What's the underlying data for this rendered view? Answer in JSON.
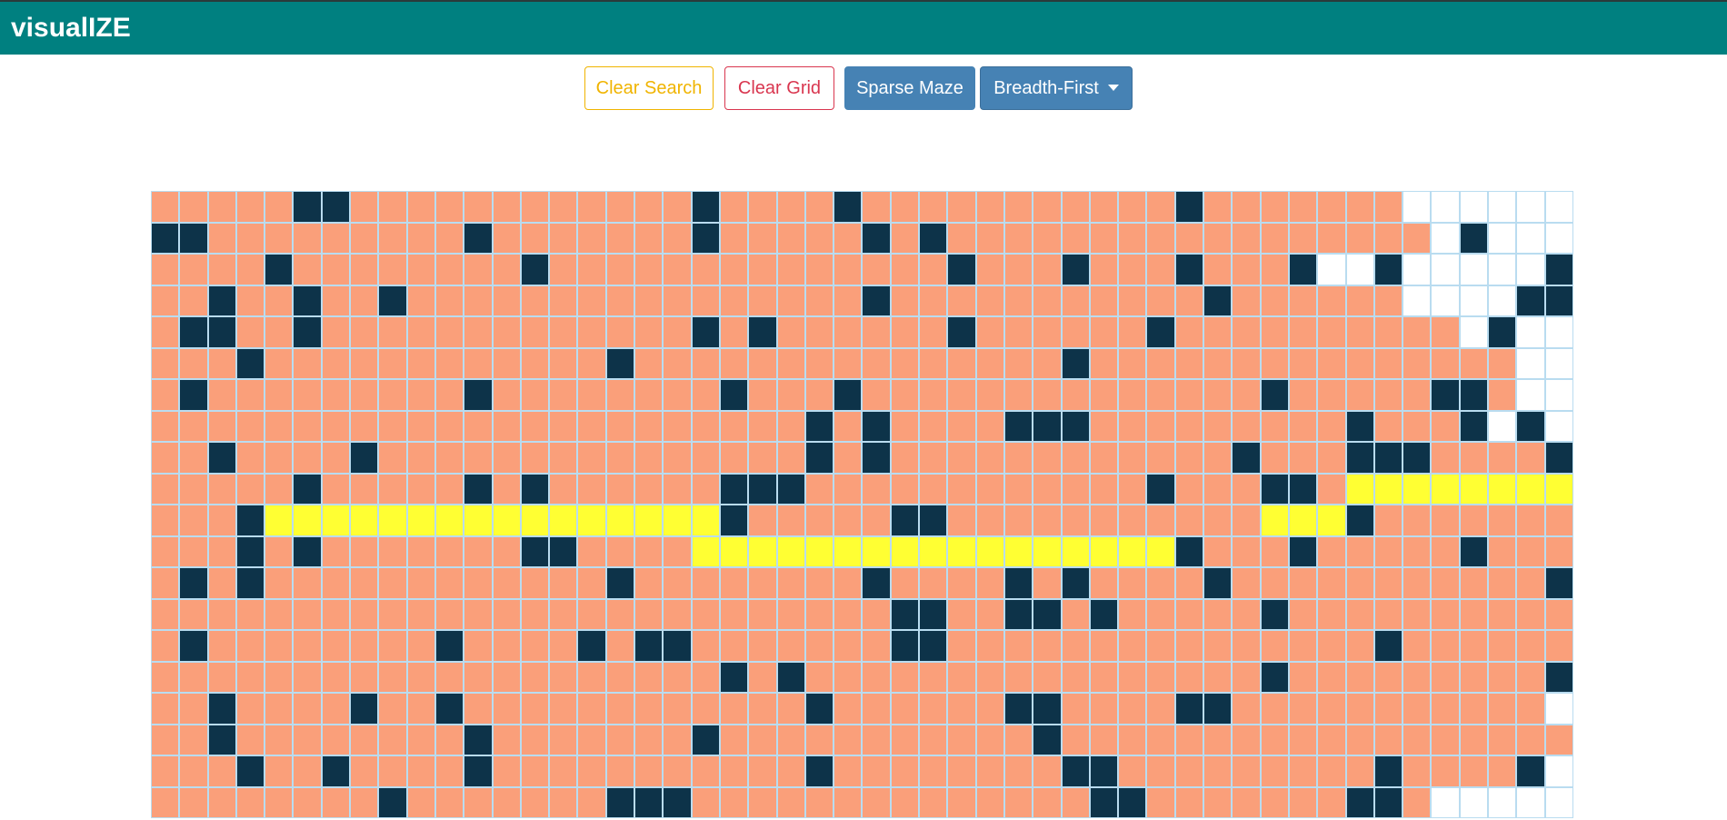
{
  "navbar": {
    "brand": "visualIZE"
  },
  "toolbar": {
    "clear_search": "Clear Search",
    "clear_grid": "Clear Grid",
    "maze_button": "Sparse Maze",
    "algorithm_dropdown": "Breadth-First"
  },
  "grid": {
    "rows": 20,
    "cols": 50,
    "legend": {
      ".": "unvisited",
      "v": "visited",
      "w": "wall",
      "p": "path"
    },
    "cells": [
      "vvvvvwwvvvvvvvvvvvvwvvvvwvvvvvvvvvvvwvvvvvvv......",
      "wwvvvvvvvvvwvvvvvvvwvvvvvwvwvvvvvvvvvvvvvvvvv.w...",
      "vvvvwvvvvvvvvwvvvvvvvvvvvvvvwvvvwvvvwvvvw..w.....w",
      "vvwvvwvvwvvvvvvvvvvvvvvvvwvvvvvvvvvvvwvvvvvv....ww.",
      "vwwvvwvvvvvvvvvvvvvwvwvvvvvvwvvvvvvwvvvvvvvvvv.w..w...",
      "vvvwvvvvvvvvvvvvwvvvvvvvvvvvvvvvwvvvvvvvvvvvvvvv......",
      "vwvvvvvvvvvwvvvvvvvvwvvvwvvvvvvvvvvvvvvwvvvvvwwv..w.ww",
      "vvvvvvvvvvvvvvvvvvvvvvvwvwvvvvwwwvvvvvvvvvwvvvw w.....",
      "vvwvvvvwvvvvvvvvvvvvvvvwvwvvvvvvvvvvvvwvvvwwwvvvvw....",
      "vvvvvwvvvvvwvwvvvvvvwwwvvvvvvvvvvvvwvvvwwvpppppppppw..",
      "vvvwppppppppppppppppwvvvvvwwvvvvvvvvvvvpppwvvvvvvvpw.w.",
      "vvvwvwvvvvvvvwwvvvvpppppppppppppppppwvvvwvvvvvwvvvv..w",
      "vwvwvvvvvvvvvvvvwvvvvvvvvwvvvvwvwvvvvwvvvvvvvvvvvw....",
      "vvvvvvvvvvvvvvvvvvvvvvvvvvwwvvwwvwvvvvvwvvvvvvvvvvv.w.",
      "vwvvvvvvvvwvvvvwvwwvvvvvvvwwvvvvvvvvvvvvvvvwvvvvvv....",
      "vvvvvvvvvvvvvvvvvvvvwvwvvvvvvvvvvvvvvvvwvvvvvvvvvw.w..",
      "vvwvvvvwvvwvvvvvvvvvvvvwvvvvvvwwvvvvwwvvvvvvvvvvv..w..",
      "vvwvvvvvvvvwvvvvvvvwvvvvvvvvvvvwvvvvvvvvvvvvvvvvvv.w.w",
      "vvvwvvwvvvvwvvvvvvvvvvvwvvvvvvvvwwvvvvvvvvvwvvvvw..ww..",
      "vvvvvvvvwvvvvvvvwwwvvvvvvvvvvvvvvwwvvvvvvvwwv.....ww.."
    ]
  }
}
